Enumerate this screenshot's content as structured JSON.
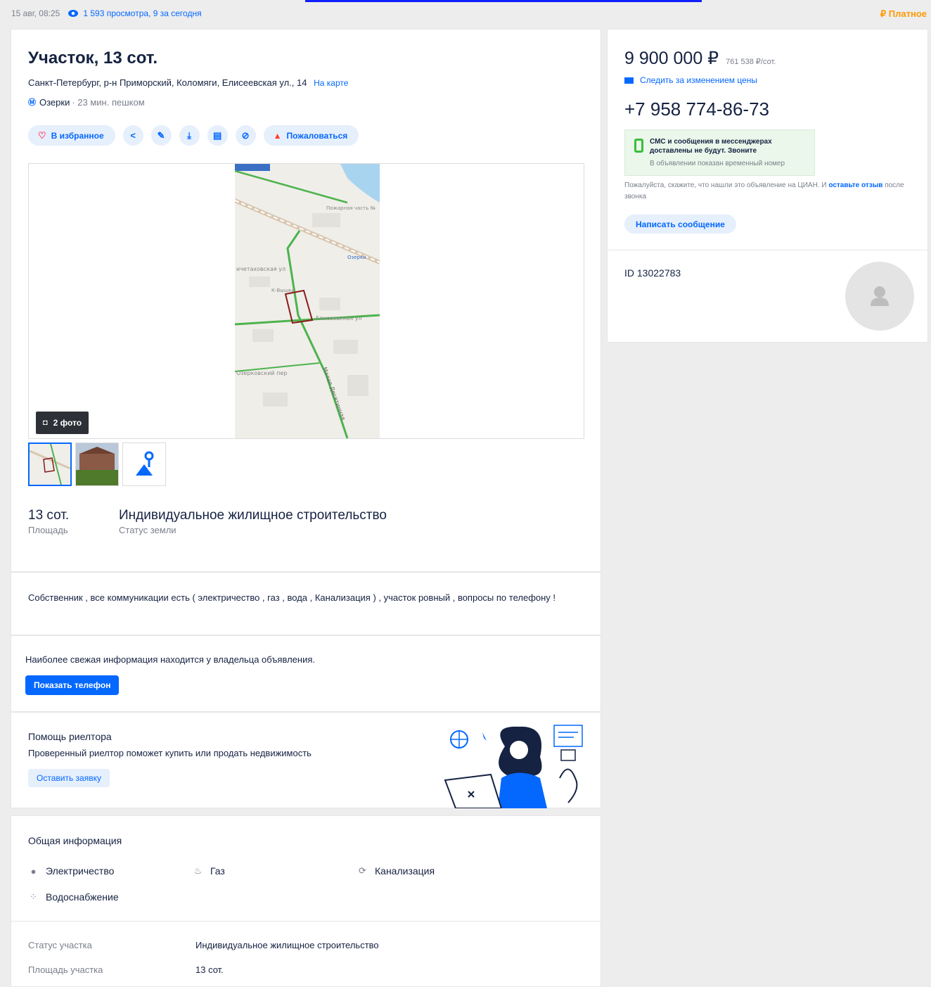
{
  "meta": {
    "date": "15 авг, 08:25",
    "views": "1 593 просмотра, 9 за сегодня",
    "paid": "₽ Платное"
  },
  "listing": {
    "title": "Участок, 13 сот.",
    "address": "Санкт-Петербург, р-н Приморский, Коломяги, Елисеевская ул., 14",
    "map_link": "На карте",
    "metro_icon": "Ⓜ",
    "metro": "Озерки",
    "metro_time": "· 23 мин. пешком"
  },
  "actions": {
    "favorite": "В избранное",
    "complain": "Пожаловаться"
  },
  "gallery": {
    "photo_count": "2 фото",
    "map_labels": [
      "Пожарная часть №",
      "Озерки",
      "ичетаховская ул",
      "К-Вышки",
      "Елисеевская ул",
      "Озерковский пер",
      "Малая Десятинная"
    ]
  },
  "facts": [
    {
      "value": "13 сот.",
      "label": "Площадь"
    },
    {
      "value": "Индивидуальное жилищное строительство",
      "label": "Статус земли"
    }
  ],
  "description": "Собственник , все коммуникации есть ( электричество , газ , вода , Канализация ) , участок ровный , вопросы по телефону !",
  "phone_block": {
    "text": "Наиболее свежая информация находится у владельца объявления.",
    "button": "Показать телефон"
  },
  "realtor": {
    "heading": "Помощь риелтора",
    "subtitle": "Проверенный риелтор поможет купить или продать недвижимость",
    "button": "Оставить заявку"
  },
  "general": {
    "heading": "Общая информация",
    "features": [
      {
        "label": "Электричество",
        "icon": "bulb-icon"
      },
      {
        "label": "Газ",
        "icon": "gas-icon"
      },
      {
        "label": "Канализация",
        "icon": "sewer-icon"
      },
      {
        "label": "Водоснабжение",
        "icon": "water-icon"
      }
    ],
    "rows": [
      {
        "key": "Статус участка",
        "value": "Индивидуальное жилищное строительство"
      },
      {
        "key": "Площадь участка",
        "value": "13 сот."
      }
    ]
  },
  "sidebar": {
    "price": "9 900 000 ₽",
    "price_per": "761 538 ₽/сот.",
    "follow": "Следить за изменением цены",
    "phone": "+7 958 774-86-73",
    "sms_title": "СМС и сообщения в мессенджерах доставлены не будут. Звоните",
    "sms_note": "В объявлении показан временный номер",
    "note_pre": "Пожалуйста, скажите, что нашли это объявление на ЦИАН. И",
    "note_link": "оставьте отзыв",
    "note_post": "после звонка",
    "message_button": "Написать сообщение",
    "id": "ID 13022783"
  },
  "colors": {
    "accent": "#0468ff",
    "paid": "#ff9900",
    "sms_bg": "#eaf7ea"
  }
}
